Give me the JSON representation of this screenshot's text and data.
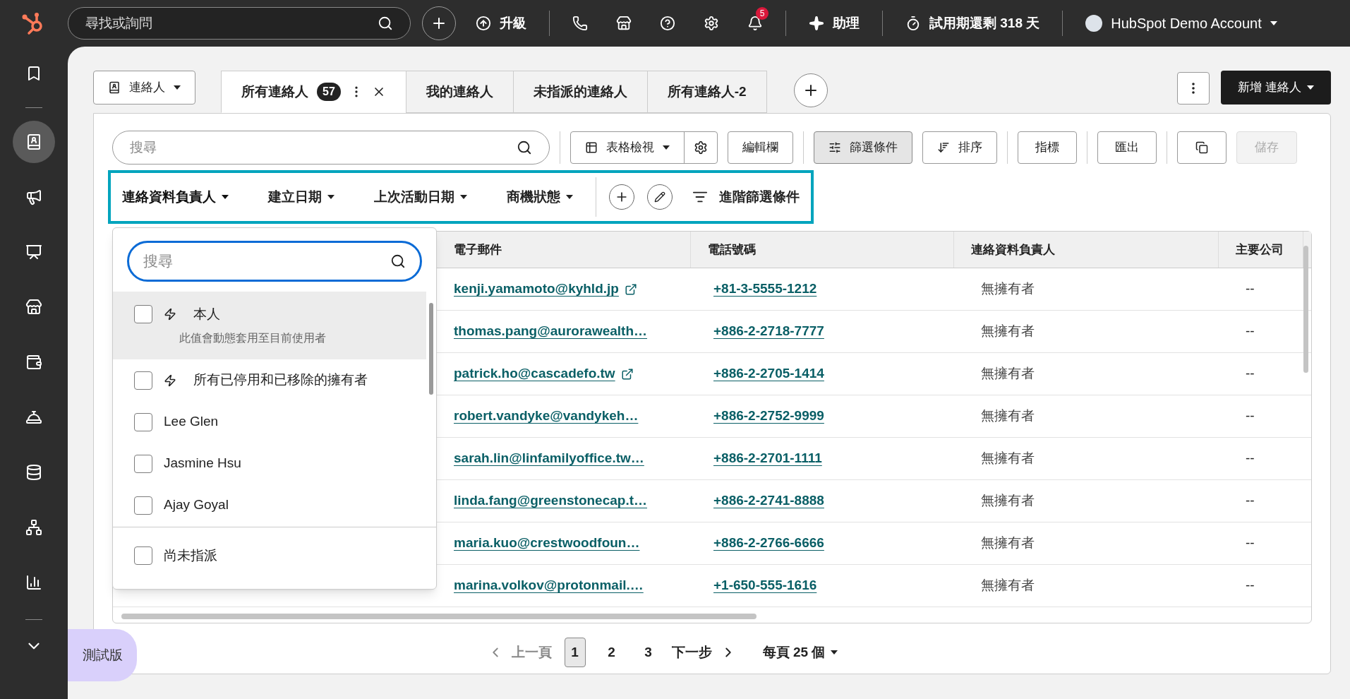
{
  "top_bar": {
    "search": {
      "placeholder": "尋找或詢問"
    },
    "upgrade": "升級",
    "notification_count": "5",
    "assistant": "助理",
    "trial": "試用期還剩 318 天",
    "account": "HubSpot Demo Account"
  },
  "sidebar": {
    "items": [
      {
        "kind": "bookmark",
        "selected": false
      },
      {
        "kind": "contacts",
        "selected": true
      },
      {
        "kind": "marketing",
        "selected": false
      },
      {
        "kind": "reports",
        "selected": false
      },
      {
        "kind": "commerce",
        "selected": false
      },
      {
        "kind": "wallet",
        "selected": false
      },
      {
        "kind": "service",
        "selected": false
      },
      {
        "kind": "data",
        "selected": false
      },
      {
        "kind": "automation",
        "selected": false
      },
      {
        "kind": "analytics",
        "selected": false
      }
    ]
  },
  "object_selector": "連絡人",
  "tabs": [
    {
      "label": "所有連絡人",
      "count": "57",
      "selected": true
    },
    {
      "label": "我的連絡人",
      "selected": false
    },
    {
      "label": "未指派的連絡人",
      "selected": false
    },
    {
      "label": "所有連絡人-2",
      "selected": false
    }
  ],
  "create_button": "新增 連絡人",
  "toolbar": {
    "search": {
      "placeholder": "搜尋"
    },
    "view": "表格檢視",
    "edit_columns": "編輯欄",
    "filters": {
      "label": "篩選條件",
      "selected": true
    },
    "sort": "排序",
    "metrics": "指標",
    "export": "匯出",
    "save": {
      "label": "儲存",
      "disabled": true
    }
  },
  "quick_filters": [
    {
      "label": "連絡資料負責人",
      "expanded": true
    },
    {
      "label": "建立日期",
      "expanded": false
    },
    {
      "label": "上次活動日期",
      "expanded": false
    },
    {
      "label": "商機狀態",
      "expanded": false
    }
  ],
  "advanced_filters": "進階篩選條件",
  "owner_dropdown": {
    "search": {
      "placeholder": "搜尋"
    },
    "options": [
      {
        "kind": "dynamic",
        "label": "本人",
        "hint": "此值會動態套用至目前使用者",
        "checked": false,
        "highlighted": true
      },
      {
        "kind": "dynamic",
        "label": "所有已停用和已移除的擁有者",
        "checked": false,
        "highlighted": false
      },
      {
        "kind": "user",
        "label": "Lee Glen",
        "checked": false,
        "highlighted": false
      },
      {
        "kind": "user",
        "label": "Jasmine Hsu",
        "checked": false,
        "highlighted": false
      },
      {
        "kind": "user",
        "label": "Ajay Goyal",
        "checked": false,
        "highlighted": false
      }
    ],
    "footer_option": {
      "label": "尚未指派",
      "checked": false
    }
  },
  "table": {
    "columns": [
      "電子郵件",
      "電話號碼",
      "連絡資料負責人",
      "主要公司"
    ],
    "rows": [
      {
        "email": "kenji.yamamoto@kyhld.jp",
        "external_link": true,
        "phone": "+81-3-5555-1212",
        "owner": "無擁有者",
        "company": "--"
      },
      {
        "email": "thomas.pang@aurorawealth…",
        "external_link": false,
        "phone": "+886-2-2718-7777",
        "owner": "無擁有者",
        "company": "--"
      },
      {
        "email": "patrick.ho@cascadefo.tw",
        "external_link": true,
        "phone": "+886-2-2705-1414",
        "owner": "無擁有者",
        "company": "--"
      },
      {
        "email": "robert.vandyke@vandykeh…",
        "external_link": false,
        "phone": "+886-2-2752-9999",
        "owner": "無擁有者",
        "company": "--"
      },
      {
        "email": "sarah.lin@linfamilyoffice.tw…",
        "external_link": false,
        "phone": "+886-2-2701-1111",
        "owner": "無擁有者",
        "company": "--"
      },
      {
        "email": "linda.fang@greenstonecap.t…",
        "external_link": false,
        "phone": "+886-2-2741-8888",
        "owner": "無擁有者",
        "company": "--"
      },
      {
        "email": "maria.kuo@crestwoodfoun…",
        "external_link": false,
        "phone": "+886-2-2766-6666",
        "owner": "無擁有者",
        "company": "--"
      },
      {
        "email": "marina.volkov@protonmail.…",
        "external_link": false,
        "phone": "+1-650-555-1616",
        "owner": "無擁有者",
        "company": "--"
      }
    ]
  },
  "pagination": {
    "previous": {
      "label": "上一頁",
      "disabled": true
    },
    "pages": [
      {
        "label": "1",
        "selected": true
      },
      {
        "label": "2",
        "selected": false
      },
      {
        "label": "3",
        "selected": false
      }
    ],
    "next": {
      "label": "下一步",
      "disabled": false
    },
    "per_page": "每頁 25 個"
  },
  "beta_badge": "測試版"
}
